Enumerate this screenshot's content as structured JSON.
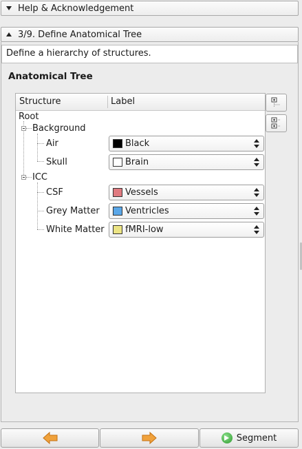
{
  "help_section": {
    "title": "Help & Acknowledgement"
  },
  "step_section": {
    "title": "3/9. Define Anatomical Tree",
    "description": "Define a hierarchy of structures.",
    "group_title": "Anatomical Tree"
  },
  "tree": {
    "columns": {
      "structure": "Structure",
      "label": "Label"
    },
    "root": "Root",
    "groups": [
      {
        "name": "Background",
        "expanded": true,
        "children": [
          {
            "structure": "Air",
            "label": "Black",
            "color": "#000000"
          },
          {
            "structure": "Skull",
            "label": "Brain",
            "color": "#ffffff"
          }
        ]
      },
      {
        "name": "ICC",
        "expanded": true,
        "children": [
          {
            "structure": "CSF",
            "label": "Vessels",
            "color": "#e07a80"
          },
          {
            "structure": "Grey Matter",
            "label": "Ventricles",
            "color": "#5aa7e8"
          },
          {
            "structure": "White Matter",
            "label": "fMRI-low",
            "color": "#ece484"
          }
        ]
      }
    ]
  },
  "side_buttons": [
    {
      "icon": "add-structure-icon"
    },
    {
      "icon": "expand-tree-icon"
    }
  ],
  "nav": {
    "back_icon": "arrow-left-icon",
    "next_icon": "arrow-right-icon",
    "segment_label": "Segment",
    "segment_icon": "segment-go-icon"
  },
  "colors": {
    "arrow_orange": "#f0a23c"
  }
}
